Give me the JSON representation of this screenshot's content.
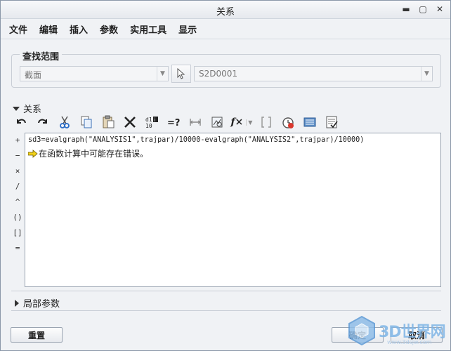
{
  "window": {
    "title": "关系",
    "buttons": {
      "close": "✕",
      "minimize": "▬",
      "maximize": "▢"
    }
  },
  "menu": [
    "文件",
    "编辑",
    "插入",
    "参数",
    "实用工具",
    "显示"
  ],
  "search": {
    "group_label": "查找范围",
    "type_value": "截面",
    "object_value": "S2D0001"
  },
  "relations": {
    "section_label": "关系",
    "toolbar": [
      "undo-icon",
      "redo-icon",
      "cut-icon",
      "copy-icon",
      "paste-icon",
      "delete-icon",
      "switch-dims-icon",
      "evaluate-icon",
      "dimension-icon",
      "parameter-insert-icon",
      "function-icon",
      "brackets-icon",
      "verify-icon",
      "sort-icon",
      "sheet-icon"
    ],
    "function_label": "f×",
    "evaluate_label": "=?",
    "operators": [
      "+",
      "−",
      "×",
      "/",
      "^",
      "()",
      "[]",
      "="
    ],
    "line1": "sd3=evalgraph(\"ANALYSIS1\",trajpar)/10000-evalgraph(\"ANALYSIS2\",trajpar)/10000)",
    "line2": "在函数计算中可能存在错误。"
  },
  "local_params": {
    "label": "局部参数"
  },
  "buttons": {
    "reset": "重置",
    "ok": "确定",
    "cancel": "取消"
  },
  "watermark": {
    "text": "3D世界网",
    "url": "www.3dsjw.com"
  }
}
